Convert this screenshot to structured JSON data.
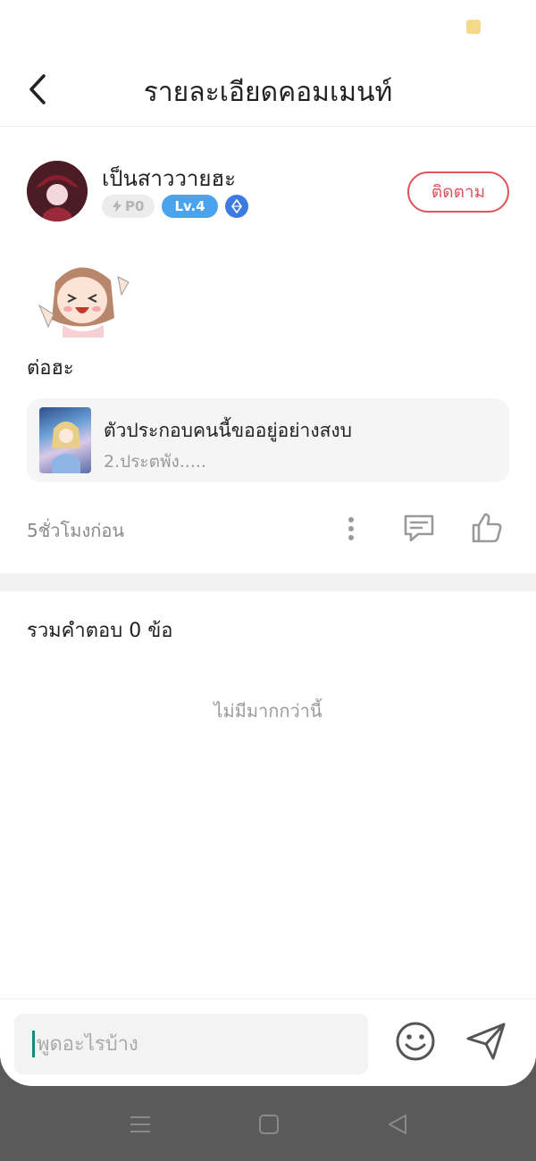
{
  "header": {
    "title": "รายละเอียดคอมเมนท์"
  },
  "user": {
    "name": "เป็นสาววายฮะ",
    "points_badge": "P0",
    "level_badge": "Lv.4",
    "follow_label": "ติดตาม"
  },
  "comment": {
    "text": "ต่อฮะ",
    "book_title": "ตัวประกอบคนนี้ขออยู่อย่างสงบ",
    "book_subtitle": "2.ประตพัง.....",
    "time": "5ชั่วโมงก่อน"
  },
  "replies": {
    "title": "รวมคำตอบ 0 ข้อ",
    "empty_text": "ไม่มีมากกว่านี้"
  },
  "input": {
    "placeholder": "พูดอะไรบ้าง"
  },
  "icons": {
    "back": "chevron-left-icon",
    "more": "more-vertical-icon",
    "comment": "comment-icon",
    "like": "thumbs-up-icon",
    "emoji": "smiley-icon",
    "send": "send-icon"
  },
  "colors": {
    "accent": "#e0555b",
    "level": "#4ba3ee",
    "gem": "#3c7ce2",
    "caret": "#0f8b7c"
  }
}
